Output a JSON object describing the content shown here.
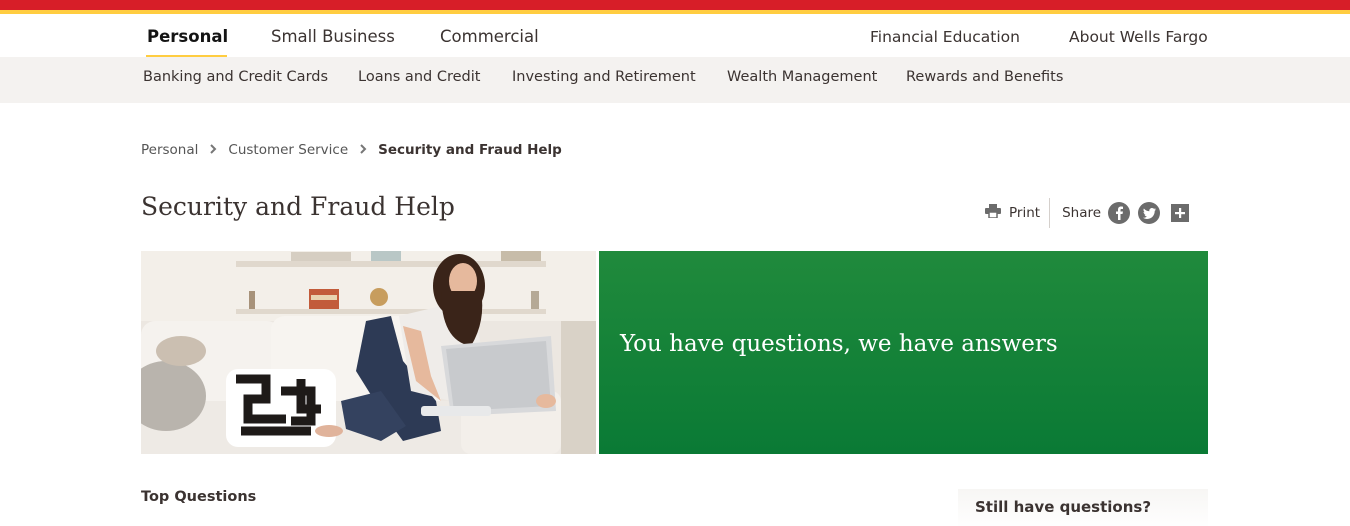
{
  "primary_nav": {
    "personal": "Personal",
    "small_business": "Small Business",
    "commercial": "Commercial",
    "financial_education": "Financial Education",
    "about": "About Wells Fargo"
  },
  "secondary_nav": {
    "items": [
      "Banking and Credit Cards",
      "Loans and Credit",
      "Investing and Retirement",
      "Wealth Management",
      "Rewards and Benefits"
    ]
  },
  "breadcrumb": {
    "items": [
      "Personal",
      "Customer Service",
      "Security and Fraud Help"
    ]
  },
  "page_title": "Security and Fraud Help",
  "tools": {
    "print": "Print",
    "share": "Share",
    "icons": [
      "print-icon",
      "facebook-icon",
      "twitter-icon",
      "plus-icon"
    ]
  },
  "hero": {
    "headline": "You have questions, we have answers",
    "image": "woman-with-laptop-on-sofa"
  },
  "content": {
    "top_questions": "Top Questions",
    "still_have_questions": "Still have questions?"
  },
  "colors": {
    "brand_red": "#d71e28",
    "brand_yellow": "#ffcd41",
    "hero_green": "#138a3a",
    "secondary_nav_bg": "#f4f2f0"
  }
}
